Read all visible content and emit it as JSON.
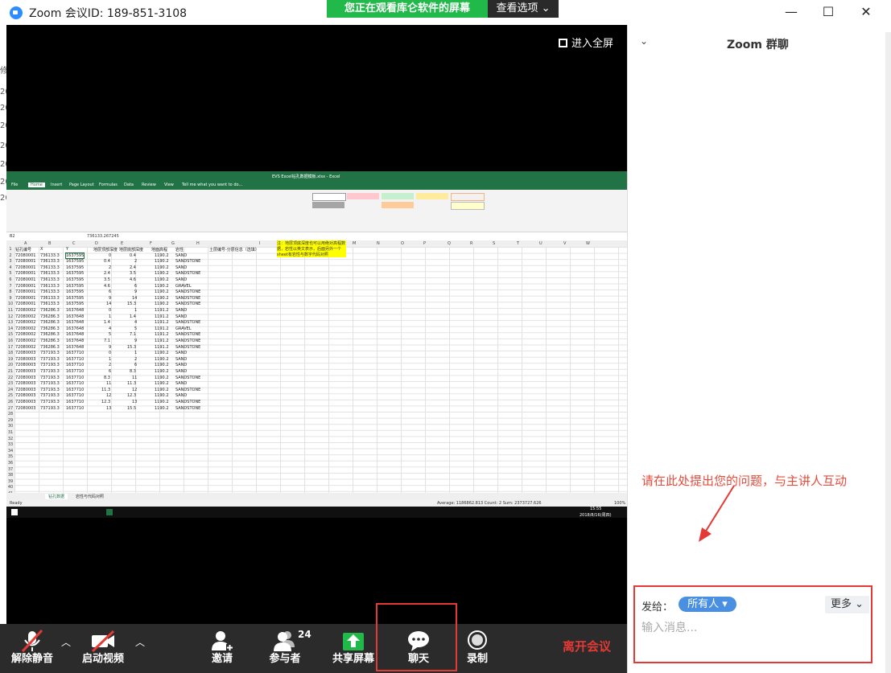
{
  "window": {
    "title": "Zoom 会议ID: 189-851-3108",
    "banner": "您正在观看库仑软件的屏幕",
    "view_options": "查看选项 ⌄",
    "minimize": "—",
    "maximize": "☐",
    "close": "✕"
  },
  "share": {
    "fullscreen_label": "进入全屏"
  },
  "excel": {
    "title": "EVS Excel钻孔数据模板.xlsx - Excel",
    "tabs": [
      "File",
      "Home",
      "Insert",
      "Page Layout",
      "Formulas",
      "Data",
      "Review",
      "View",
      "Tell me what you want to do..."
    ],
    "name_box": "B2",
    "formula": "736133.267245",
    "columns": [
      "A",
      "B",
      "C",
      "D",
      "E",
      "F",
      "G",
      "H",
      "I",
      "J",
      "K",
      "L",
      "M",
      "N",
      "O",
      "P",
      "Q",
      "R",
      "S",
      "T",
      "U",
      "V",
      "W"
    ],
    "header": [
      "钻孔编号",
      "X",
      "Y",
      "地层顶部深度",
      "地层底部深度",
      "地面高程",
      "岩性",
      "土层编号-分层信息（选填）"
    ],
    "note": "注：地层顶底深度也可以用绝对高程数据，岩性以英文表示，后面另外一个sheet有岩性与数字代码对照",
    "rows": [
      [
        "72080001",
        "736133.3",
        "1637595",
        "0",
        "0.4",
        "1190.2",
        "SAND"
      ],
      [
        "72080001",
        "736133.3",
        "1637595",
        "0.4",
        "2",
        "1190.2",
        "SANDSTONE"
      ],
      [
        "72080001",
        "736133.3",
        "1637595",
        "2",
        "2.4",
        "1190.2",
        "SAND"
      ],
      [
        "72080001",
        "736133.3",
        "1637595",
        "2.4",
        "3.5",
        "1190.2",
        "SANDSTONE"
      ],
      [
        "72080001",
        "736133.3",
        "1637595",
        "3.5",
        "4.6",
        "1190.2",
        "SAND"
      ],
      [
        "72080001",
        "736133.3",
        "1637595",
        "4.6",
        "6",
        "1190.2",
        "GRAVEL"
      ],
      [
        "72080001",
        "736133.3",
        "1637595",
        "6",
        "9",
        "1190.2",
        "SANDSTONE"
      ],
      [
        "72080001",
        "736133.3",
        "1637595",
        "9",
        "14",
        "1190.2",
        "SANDSTONE"
      ],
      [
        "72080001",
        "736133.3",
        "1637595",
        "14",
        "15.3",
        "1190.2",
        "SANDSTONE"
      ],
      [
        "72080002",
        "736286.3",
        "1637648",
        "0",
        "1",
        "1191.2",
        "SAND"
      ],
      [
        "72080002",
        "736286.3",
        "1637648",
        "1",
        "1.4",
        "1191.2",
        "SAND"
      ],
      [
        "72080002",
        "736286.3",
        "1637648",
        "1.4",
        "4",
        "1191.2",
        "SANDSTONE"
      ],
      [
        "72080002",
        "736286.3",
        "1637648",
        "4",
        "5",
        "1191.2",
        "GRAVEL"
      ],
      [
        "72080002",
        "736286.3",
        "1637648",
        "5",
        "7.1",
        "1191.2",
        "SANDSTONE"
      ],
      [
        "72080002",
        "736286.3",
        "1637648",
        "7.1",
        "9",
        "1191.2",
        "SANDSTONE"
      ],
      [
        "72080002",
        "736286.3",
        "1637648",
        "9",
        "15.3",
        "1191.2",
        "SANDSTONE"
      ],
      [
        "72080003",
        "737193.3",
        "1637710",
        "0",
        "1",
        "1190.2",
        "SAND"
      ],
      [
        "72080003",
        "737193.3",
        "1637710",
        "1",
        "2",
        "1190.2",
        "SAND"
      ],
      [
        "72080003",
        "737193.3",
        "1637710",
        "2",
        "6",
        "1190.2",
        "SAND"
      ],
      [
        "72080003",
        "737193.3",
        "1637710",
        "6",
        "8.3",
        "1190.2",
        "SAND"
      ],
      [
        "72080003",
        "737193.3",
        "1637710",
        "8.3",
        "11",
        "1190.2",
        "SANDSTONE"
      ],
      [
        "72080003",
        "737193.3",
        "1637710",
        "11",
        "11.3",
        "1190.2",
        "SAND"
      ],
      [
        "72080003",
        "737193.3",
        "1637710",
        "11.3",
        "12",
        "1190.2",
        "SANDSTONE"
      ],
      [
        "72080003",
        "737193.3",
        "1637710",
        "12",
        "12.3",
        "1190.2",
        "SAND"
      ],
      [
        "72080003",
        "737193.3",
        "1637710",
        "12.3",
        "13",
        "1190.2",
        "SANDSTONE"
      ],
      [
        "72080003",
        "737193.3",
        "1637710",
        "13",
        "15.5",
        "1190.2",
        "SANDSTONE"
      ]
    ],
    "sheet_tabs": [
      "钻孔数据",
      "岩性与代码对照"
    ],
    "status_left": "Ready",
    "status_right": "Average: 1186862.813   Count: 2   Sum: 2373727.626",
    "zoom": "100%",
    "clock": "15:55",
    "date": "2018/8/16(周四)"
  },
  "chat": {
    "title": "Zoom 群聊",
    "hint": "请在此处提出您的问题，与主讲人互动",
    "send_to_label": "发给：",
    "recipient": "所有人 ▾",
    "more": "更多 ⌄",
    "placeholder": "输入消息..."
  },
  "toolbar": {
    "unmute": "解除静音",
    "start_video": "启动视频",
    "invite": "邀请",
    "participants": "参与者",
    "participants_count": "24",
    "share_screen": "共享屏幕",
    "chat": "聊天",
    "record": "录制",
    "leave": "离开会议"
  }
}
